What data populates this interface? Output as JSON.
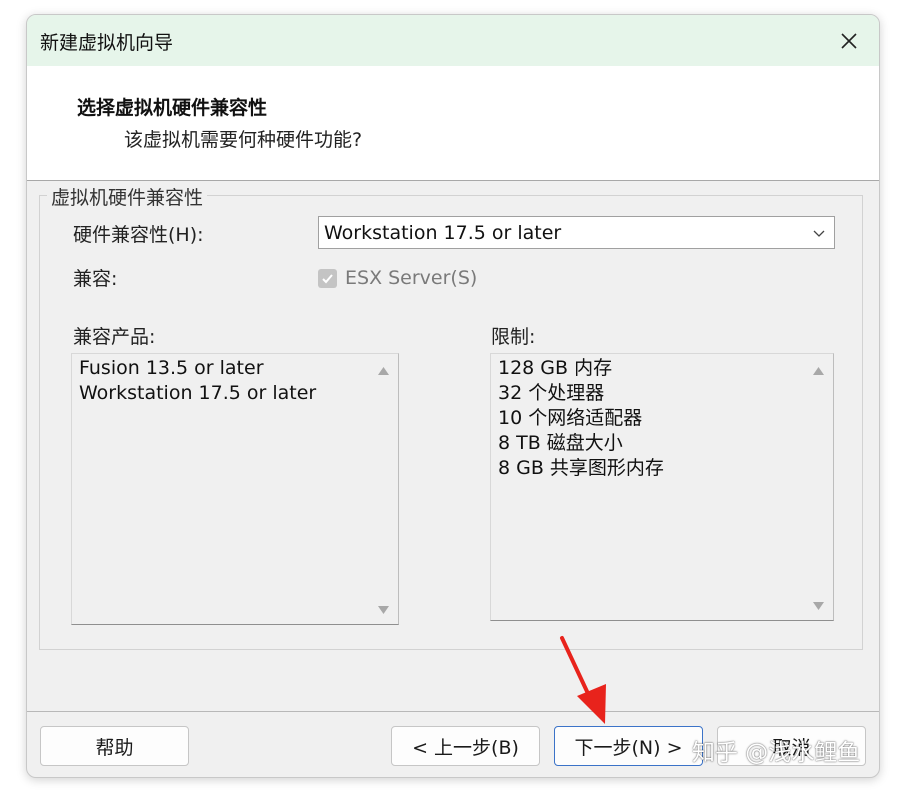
{
  "window": {
    "title": "新建虚拟机向导"
  },
  "header": {
    "title": "选择虚拟机硬件兼容性",
    "subtitle": "该虚拟机需要何种硬件功能?"
  },
  "group": {
    "legend": "虚拟机硬件兼容性",
    "hardware_label": "硬件兼容性(H):",
    "hardware_selected": "Workstation 17.5 or later",
    "compat_label": "兼容:",
    "esx_checkbox_label": "ESX Server(S)",
    "esx_checked": true,
    "products_label": "兼容产品:",
    "products": [
      "Fusion 13.5 or later",
      "Workstation 17.5 or later"
    ],
    "limits_label": "限制:",
    "limits": [
      "128 GB 内存",
      "32 个处理器",
      "10 个网络适配器",
      "8 TB 磁盘大小",
      "8 GB 共享图形内存"
    ]
  },
  "footer": {
    "help_label": "帮助",
    "back_label": "< 上一步(B)",
    "next_label": "下一步(N) >",
    "cancel_label": "取消"
  },
  "watermark": "知乎 @浅水鲤鱼",
  "colors": {
    "titlebar_bg": "#e6f5ea",
    "annotation_arrow": "#e8231c",
    "primary_border": "#3b73c8"
  },
  "icons": {
    "close": "close-icon",
    "dropdown": "chevron-down-icon",
    "check": "check-icon",
    "scroll_up": "scroll-up-arrow-icon",
    "scroll_down": "scroll-down-arrow-icon",
    "annotation": "red-arrow-annotation"
  }
}
